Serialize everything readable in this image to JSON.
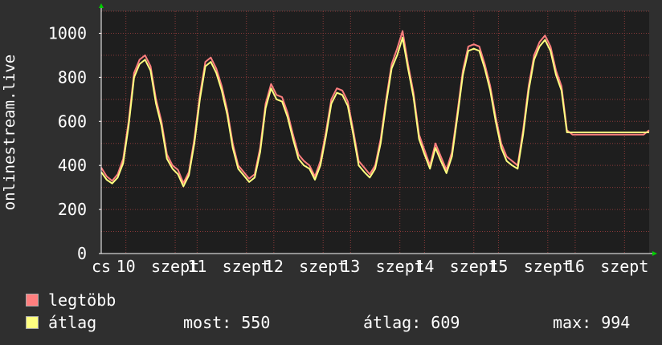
{
  "chart_data": {
    "type": "line",
    "ylabel": "onlinestream.live",
    "ylim": [
      0,
      1100
    ],
    "yticks": [
      0,
      200,
      400,
      600,
      800,
      1000
    ],
    "grid": true,
    "x_tick_labels": [
      "cs",
      "10",
      "szept",
      "11",
      "szept",
      "12",
      "szept",
      "13",
      "szept",
      "14",
      "szept",
      "15",
      "szept",
      "16",
      "szept"
    ],
    "x_tick_positions": [
      0.0,
      0.045,
      0.135,
      0.175,
      0.265,
      0.315,
      0.405,
      0.455,
      0.545,
      0.59,
      0.68,
      0.725,
      0.815,
      0.865,
      0.955
    ],
    "x_range": [
      0,
      1
    ],
    "series": [
      {
        "name": "legtöbb",
        "color": "#ff7f7f",
        "x": [
          0.0,
          0.01,
          0.02,
          0.03,
          0.04,
          0.05,
          0.06,
          0.07,
          0.08,
          0.09,
          0.1,
          0.11,
          0.12,
          0.13,
          0.14,
          0.15,
          0.16,
          0.17,
          0.18,
          0.19,
          0.2,
          0.21,
          0.22,
          0.23,
          0.24,
          0.25,
          0.26,
          0.27,
          0.28,
          0.29,
          0.3,
          0.31,
          0.32,
          0.33,
          0.34,
          0.35,
          0.36,
          0.37,
          0.38,
          0.39,
          0.4,
          0.41,
          0.42,
          0.43,
          0.44,
          0.45,
          0.46,
          0.47,
          0.48,
          0.49,
          0.5,
          0.51,
          0.52,
          0.53,
          0.54,
          0.55,
          0.56,
          0.57,
          0.58,
          0.59,
          0.6,
          0.61,
          0.62,
          0.63,
          0.64,
          0.65,
          0.66,
          0.67,
          0.68,
          0.69,
          0.7,
          0.71,
          0.72,
          0.73,
          0.74,
          0.75,
          0.76,
          0.77,
          0.78,
          0.79,
          0.8,
          0.81,
          0.82,
          0.83,
          0.84,
          0.85,
          0.86,
          0.87,
          0.88,
          0.89,
          0.9,
          0.91,
          0.92,
          0.93,
          0.94,
          0.95,
          0.96,
          0.97,
          0.98,
          0.99,
          1.0
        ],
        "values": [
          390,
          350,
          330,
          360,
          430,
          600,
          820,
          880,
          900,
          850,
          700,
          600,
          450,
          400,
          380,
          320,
          370,
          520,
          720,
          870,
          890,
          840,
          760,
          650,
          500,
          400,
          370,
          340,
          360,
          480,
          680,
          770,
          720,
          710,
          640,
          540,
          450,
          420,
          400,
          350,
          420,
          550,
          700,
          750,
          740,
          690,
          560,
          420,
          390,
          360,
          400,
          520,
          700,
          860,
          930,
          1010,
          860,
          730,
          540,
          470,
          400,
          500,
          440,
          380,
          460,
          640,
          830,
          940,
          950,
          940,
          860,
          760,
          620,
          500,
          440,
          420,
          400,
          560,
          760,
          900,
          960,
          990,
          940,
          830,
          760,
          560,
          540,
          540,
          540,
          540,
          540,
          540,
          540,
          540,
          540,
          540,
          540,
          540,
          540,
          540,
          560
        ]
      },
      {
        "name": "átlag",
        "color": "#ffff80",
        "x": [
          0.0,
          0.01,
          0.02,
          0.03,
          0.04,
          0.05,
          0.06,
          0.07,
          0.08,
          0.09,
          0.1,
          0.11,
          0.12,
          0.13,
          0.14,
          0.15,
          0.16,
          0.17,
          0.18,
          0.19,
          0.2,
          0.21,
          0.22,
          0.23,
          0.24,
          0.25,
          0.26,
          0.27,
          0.28,
          0.29,
          0.3,
          0.31,
          0.32,
          0.33,
          0.34,
          0.35,
          0.36,
          0.37,
          0.38,
          0.39,
          0.4,
          0.41,
          0.42,
          0.43,
          0.44,
          0.45,
          0.46,
          0.47,
          0.48,
          0.49,
          0.5,
          0.51,
          0.52,
          0.53,
          0.54,
          0.55,
          0.56,
          0.57,
          0.58,
          0.59,
          0.6,
          0.61,
          0.62,
          0.63,
          0.64,
          0.65,
          0.66,
          0.67,
          0.68,
          0.69,
          0.7,
          0.71,
          0.72,
          0.73,
          0.74,
          0.75,
          0.76,
          0.77,
          0.78,
          0.79,
          0.8,
          0.81,
          0.82,
          0.83,
          0.84,
          0.85,
          0.86,
          0.87,
          0.88,
          0.89,
          0.9,
          0.91,
          0.92,
          0.93,
          0.94,
          0.95,
          0.96,
          0.97,
          0.98,
          0.99,
          1.0
        ],
        "values": [
          370,
          335,
          318,
          345,
          410,
          580,
          800,
          860,
          880,
          830,
          680,
          580,
          430,
          385,
          360,
          305,
          355,
          500,
          700,
          850,
          870,
          820,
          740,
          630,
          480,
          385,
          355,
          325,
          345,
          460,
          660,
          750,
          700,
          690,
          620,
          520,
          430,
          400,
          385,
          335,
          400,
          530,
          680,
          730,
          720,
          670,
          540,
          400,
          370,
          345,
          385,
          500,
          680,
          840,
          900,
          980,
          840,
          710,
          520,
          450,
          385,
          480,
          420,
          365,
          440,
          620,
          810,
          920,
          930,
          920,
          840,
          740,
          600,
          480,
          420,
          400,
          385,
          540,
          740,
          880,
          940,
          970,
          920,
          810,
          740,
          550,
          550,
          550,
          550,
          550,
          550,
          550,
          550,
          550,
          550,
          550,
          550,
          550,
          550,
          550,
          550
        ]
      }
    ]
  },
  "legend": [
    {
      "label": "legtöbb",
      "color": "#ff7f7f"
    },
    {
      "label": "átlag",
      "color": "#ffff80"
    }
  ],
  "stats": {
    "most": "most: 550",
    "atlag": "átlag: 609",
    "max": "max: 994"
  },
  "colors": {
    "background": "#2f2f2f",
    "plot_background": "#1e1e1e",
    "grid": "#8b3a3a",
    "axis": "#ffffff",
    "arrow": "#00cc00"
  }
}
